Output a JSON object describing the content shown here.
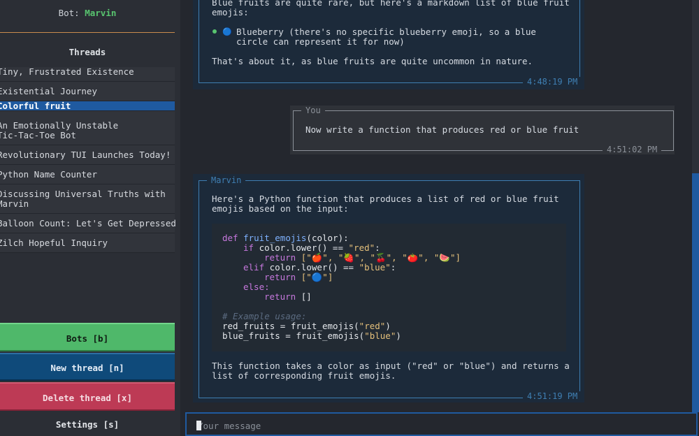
{
  "sidebar": {
    "bot_label": "Bot: ",
    "bot_name": "Marvin",
    "threads_title": "Threads",
    "threads": [
      {
        "title": "Tiny, Frustrated Existence"
      },
      {
        "title": "Existential Journey"
      },
      {
        "title": "Colorful fruit",
        "active": true
      },
      {
        "title": "An Emotionally Unstable\nTic-Tac-Toe Bot"
      },
      {
        "title": "Revolutionary TUI Launches Today!"
      },
      {
        "title": "Python Name Counter"
      },
      {
        "title": "Discussing Universal Truths with\nMarvin"
      },
      {
        "title": "Balloon Count: Let's Get Depressed"
      },
      {
        "title": "Zilch Hopeful Inquiry"
      }
    ],
    "buttons": {
      "bots": "Bots [b]",
      "new_thread": "New thread [n]",
      "delete_thread": "Delete thread [x]",
      "settings": "Settings [s]"
    }
  },
  "messages": {
    "m1": {
      "line1": "Blue fruits are quite rare, but here's a markdown list of blue fruit",
      "line2": "emojis:",
      "bullet_emoji": "🔵",
      "bullet_l1": "Blueberry (there's no specific blueberry emoji, so a blue",
      "bullet_l2": "circle can represent it for now)",
      "closing": "That's about it, as blue fruits are quite uncommon in nature.",
      "timestamp": "4:48:19 PM"
    },
    "m2": {
      "author": "You",
      "text": "Now write a function that produces red or blue fruit",
      "timestamp": "4:51:02 PM"
    },
    "m3": {
      "author": "Marvin",
      "intro_l1": "Here's a Python function that produces a list of red or blue fruit",
      "intro_l2": "emojis based on the input:",
      "code": {
        "c1_kw": "def ",
        "c1_fn": "fruit_emojis",
        "c1_rest": "(color):",
        "c2_kw": "if ",
        "c2_a": "color.lower() == ",
        "c2_s": "\"red\"",
        "c2_b": ":",
        "c3_kw": "return ",
        "c3_rest": "[\"🍎\", \"🍓\", \"🍒\", \"🍅\", \"🍉\"]",
        "c4_kw": "elif ",
        "c4_a": "color.lower() == ",
        "c4_s": "\"blue\"",
        "c4_b": ":",
        "c5_kw": "return ",
        "c5_rest": "[\"🔵\"]",
        "c6_kw": "else:",
        "c7_kw": "return ",
        "c7_rest": "[]",
        "c8": "# Example usage:",
        "c9_a": "red_fruits = fruit_emojis(",
        "c9_s": "\"red\"",
        "c9_b": ")",
        "c10_a": "blue_fruits = fruit_emojis(",
        "c10_s": "\"blue\"",
        "c10_b": ")"
      },
      "outro_l1": "This function takes a color as input (\"red\" or \"blue\") and returns a",
      "outro_l2": "list of corresponding fruit emojis.",
      "timestamp": "4:51:19 PM"
    }
  },
  "input": {
    "placeholder": "Your message"
  },
  "colors": {
    "accent": "#1f5aa0",
    "bot_name": "#58c46f",
    "bots_button": "#4fb86a",
    "new_button": "#0f4a7a",
    "delete_button": "#bd3a55",
    "bot_border": "#3f7fb3"
  }
}
